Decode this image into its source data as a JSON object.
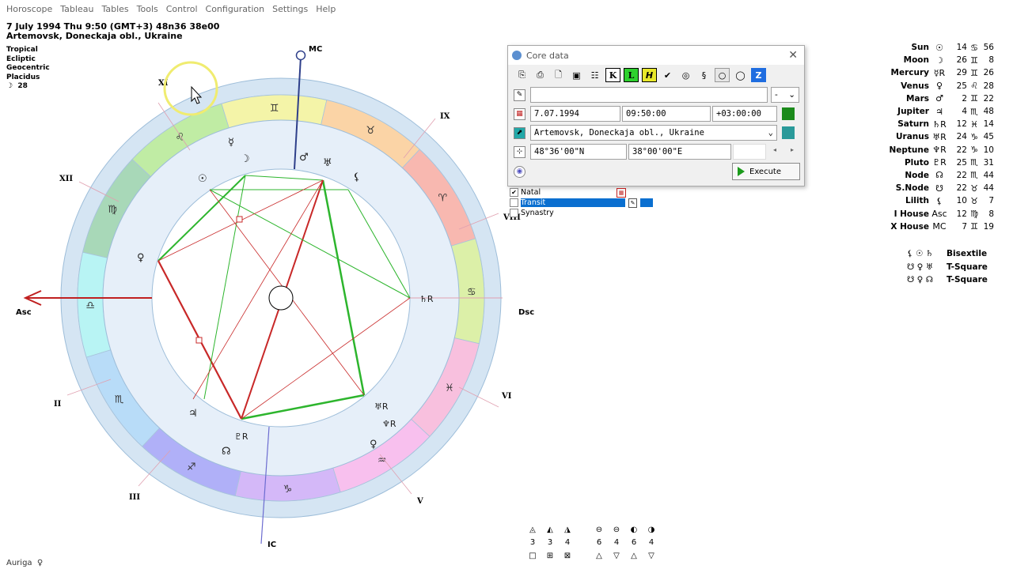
{
  "menu": [
    "Horoscope",
    "Tableau",
    "Tables",
    "Tools",
    "Control",
    "Configuration",
    "Settings",
    "Help"
  ],
  "header": {
    "line1": "7 July 1994  Thu   9:50 (GMT+3) 48n36  38e00",
    "line2": "Artemovsk, Doneckaja obl., Ukraine"
  },
  "settings": [
    "Tropical",
    "Ecliptic",
    "Geocentric",
    "Placidus"
  ],
  "moon_phase": {
    "glyph": "☽",
    "value": "28"
  },
  "chart": {
    "axes": {
      "mc": "MC",
      "ic": "IC",
      "asc": "Asc",
      "dsc": "Dsc"
    },
    "houses": [
      "XI",
      "IX",
      "XII",
      "VIII",
      "VI",
      "II",
      "III",
      "V"
    ],
    "signs": [
      "♊",
      "♉",
      "♈",
      "♋",
      "♓",
      "♌",
      "♒",
      "♍",
      "♑",
      "♎",
      "♐",
      "♏"
    ],
    "planet_glyphs": [
      "☿",
      "☽",
      "♂",
      "♅",
      "⚸",
      "☉",
      "♀",
      "♄R",
      "♅R",
      "♆R",
      "♀",
      "♃",
      "♇R",
      "☊"
    ]
  },
  "dialog": {
    "title": "Core data",
    "toolbar": [
      "copy-icon",
      "paste-icon",
      "new-icon",
      "save-icon",
      "table-icon",
      "K",
      "L",
      "H",
      "check-icon",
      "spiral-icon",
      "s-icon",
      "circle-small-icon",
      "circle-icon",
      "Z"
    ],
    "name_value": "",
    "gender_value": "-",
    "date_value": "7.07.1994",
    "time_value": "09:50:00",
    "tz_value": "+03:00:00",
    "place_value": "Artemovsk, Doneckaja obl., Ukraine",
    "lat_value": "48°36'00\"N",
    "lon_value": "38°00'00\"E",
    "execute_label": "Execute"
  },
  "layers": [
    {
      "label": "Natal",
      "checked": true
    },
    {
      "label": "Transit",
      "checked": false
    },
    {
      "label": "Synastry",
      "checked": false
    }
  ],
  "planets": [
    {
      "name": "Sun",
      "glyph": "☉",
      "deg": "14",
      "sign": "♋",
      "min": "56"
    },
    {
      "name": "Moon",
      "glyph": "☽",
      "deg": "26",
      "sign": "♊",
      "min": "8"
    },
    {
      "name": "Mercury",
      "glyph": "☿R",
      "deg": "29",
      "sign": "♊",
      "min": "26"
    },
    {
      "name": "Venus",
      "glyph": "♀",
      "deg": "25",
      "sign": "♌",
      "min": "28"
    },
    {
      "name": "Mars",
      "glyph": "♂",
      "deg": "2",
      "sign": "♊",
      "min": "22"
    },
    {
      "name": "Jupiter",
      "glyph": "♃",
      "deg": "4",
      "sign": "♏",
      "min": "48"
    },
    {
      "name": "Saturn",
      "glyph": "♄R",
      "deg": "12",
      "sign": "♓",
      "min": "14"
    },
    {
      "name": "Uranus",
      "glyph": "♅R",
      "deg": "24",
      "sign": "♑",
      "min": "45"
    },
    {
      "name": "Neptune",
      "glyph": "♆R",
      "deg": "22",
      "sign": "♑",
      "min": "10"
    },
    {
      "name": "Pluto",
      "glyph": "♇R",
      "deg": "25",
      "sign": "♏",
      "min": "31"
    },
    {
      "name": "Node",
      "glyph": "☊",
      "deg": "22",
      "sign": "♏",
      "min": "44"
    },
    {
      "name": "S.Node",
      "glyph": "☋",
      "deg": "22",
      "sign": "♉",
      "min": "44"
    },
    {
      "name": "Lilith",
      "glyph": "⚸",
      "deg": "10",
      "sign": "♉",
      "min": "7"
    },
    {
      "name": "I House",
      "glyph": "Asc",
      "deg": "12",
      "sign": "♍",
      "min": "8"
    },
    {
      "name": "X House",
      "glyph": "MC",
      "deg": "7",
      "sign": "♊",
      "min": "19"
    }
  ],
  "aspects": [
    {
      "glyphs": "⚸ ☉ ♄",
      "name": "Bisextile"
    },
    {
      "glyphs": "☋ ♀ ♅",
      "name": "T-Square"
    },
    {
      "glyphs": "☋ ♀ ☊",
      "name": "T-Square"
    }
  ],
  "stats": {
    "left_glyphs": [
      "◬",
      "◭",
      "◮"
    ],
    "left_values": [
      "3",
      "3",
      "4"
    ],
    "right_glyphs": [
      "⊖",
      "⊖",
      "◐",
      "◑"
    ],
    "right_values": [
      "6",
      "4",
      "6",
      "4"
    ],
    "row2_left": [
      "□",
      "⊞",
      "⊠"
    ],
    "row2_right": [
      "△",
      "▽",
      "△",
      "▽"
    ]
  },
  "status": {
    "label": "Auriga",
    "glyph": "♀"
  }
}
